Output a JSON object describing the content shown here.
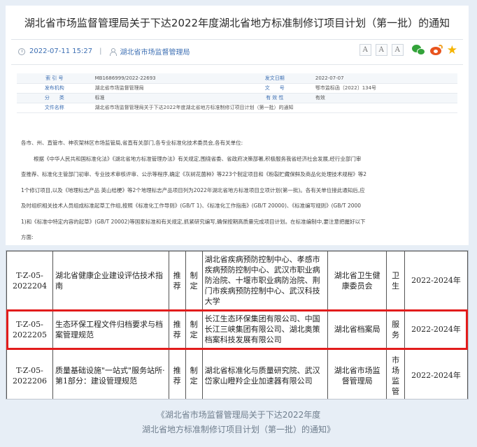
{
  "article": {
    "title": "湖北省市场监督管理局关于下达2022年度湖北省地方标准制修订项目计划（第一批）的通知",
    "date": "2022-07-11 15:27",
    "source": "湖北省市场监督管理局",
    "font_buttons": [
      "A",
      "A",
      "A"
    ],
    "share_icons": [
      "wechat-icon",
      "weibo-icon",
      "star-icon"
    ]
  },
  "info_table": [
    {
      "label1": "索 引 号",
      "value1": "MB1686999/2022-22693",
      "label2": "发文日期",
      "value2": "2022-07-07"
    },
    {
      "label1": "发布机构",
      "value1": "湖北省市场监督管理局",
      "label2": "文　　号",
      "value2": "鄂市监标函〔2022〕134号"
    },
    {
      "label1": "分　　类",
      "value1": "标准",
      "label2": "有 效 性",
      "value2": "有效"
    },
    {
      "label1": "文件名称",
      "value1": "湖北省市场监督管理局关于下达2022年度湖北省地方标准制修订项目计划（第一批）的通知",
      "label2": "",
      "value2": ""
    }
  ],
  "body": {
    "greeting": "各市、州、直管市、神农架林区市场监管局,省直有关部门,各专业标准化技术委员会,各有关单位:",
    "lines": [
      "根据《中华人民共和国标准化法》《湖北省地方标准管理办法》有关规定,围绕省委、省政府决策部署,积极服务我省经济社会发展,经行业部门审",
      "查推荐、标准化主管部门初审、专业技术审核评审、公示等程序,确定《灰树花菌种》等223个制定项目和《粉裂贮藏保鲜及商品化处理技术规程》等2",
      "1个修订项目,以及《地理标志产品 英山桔梗》等2个地理标志产品项目列为2022年湖北省地方标准项目立项计划(第一批)。各有关单位接此通知后,应",
      "及时组织相关技术人员组成标准起草工作组,按照《标准化工作导则》(GB/T 1)、《标准化工作指南》(GB/T 20000)、《标准编写规则》(GB/T 2000",
      "1)和《标准中特定内容的起草》(GB/T 20002)等国家标准和有关规定,抓紧研究编写,确保按期高质量完成项目计划。在标准编制中,要注意把握好以下",
      "方面:"
    ]
  },
  "project_rows": [
    {
      "code": "T-Z-05-2022204",
      "name": "湖北省健康企业建设评估技术指南",
      "type": "推荐",
      "nature": "制定",
      "units": "湖北省疾病预防控制中心、孝感市疾病预防控制中心、武汉市职业病防治院、十堰市职业病防治院、荆门市疾病预防控制中心、武汉科技大学",
      "dept": "湖北省卫生健康委员会",
      "field": "卫生",
      "period": "2022-2024年"
    },
    {
      "code": "T-Z-05-2022205",
      "name": "生态环保工程文件归档要求与档案管理规范",
      "type": "推荐",
      "nature": "制定",
      "units": "长江生态环保集团有限公司、中国长江三峡集团有限公司、湖北奥策档案科技发展有限公司",
      "dept": "湖北省档案局",
      "field": "服务",
      "period": "2022-2024年"
    },
    {
      "code": "T-Z-05-2022206",
      "name": "质量基础设施\"一站式\"服务站所·第1部分：建设管理规范",
      "type": "推荐",
      "nature": "制定",
      "units": "湖北省标准化与质量研究院、武汉岱家山瞪羚企业加速器有限公司",
      "dept": "湖北省市场监督管理局",
      "field": "市场监管",
      "period": "2022-2024年"
    }
  ],
  "caption": {
    "line1": "《湖北省市场监督管理局关于下达2022年度",
    "line2": "湖北省地方标准制修订项目计划（第一批）的通知》"
  },
  "colors": {
    "background": "#e7eef6",
    "link_blue": "#3d6fb3",
    "highlight_red": "#e21c1c"
  }
}
